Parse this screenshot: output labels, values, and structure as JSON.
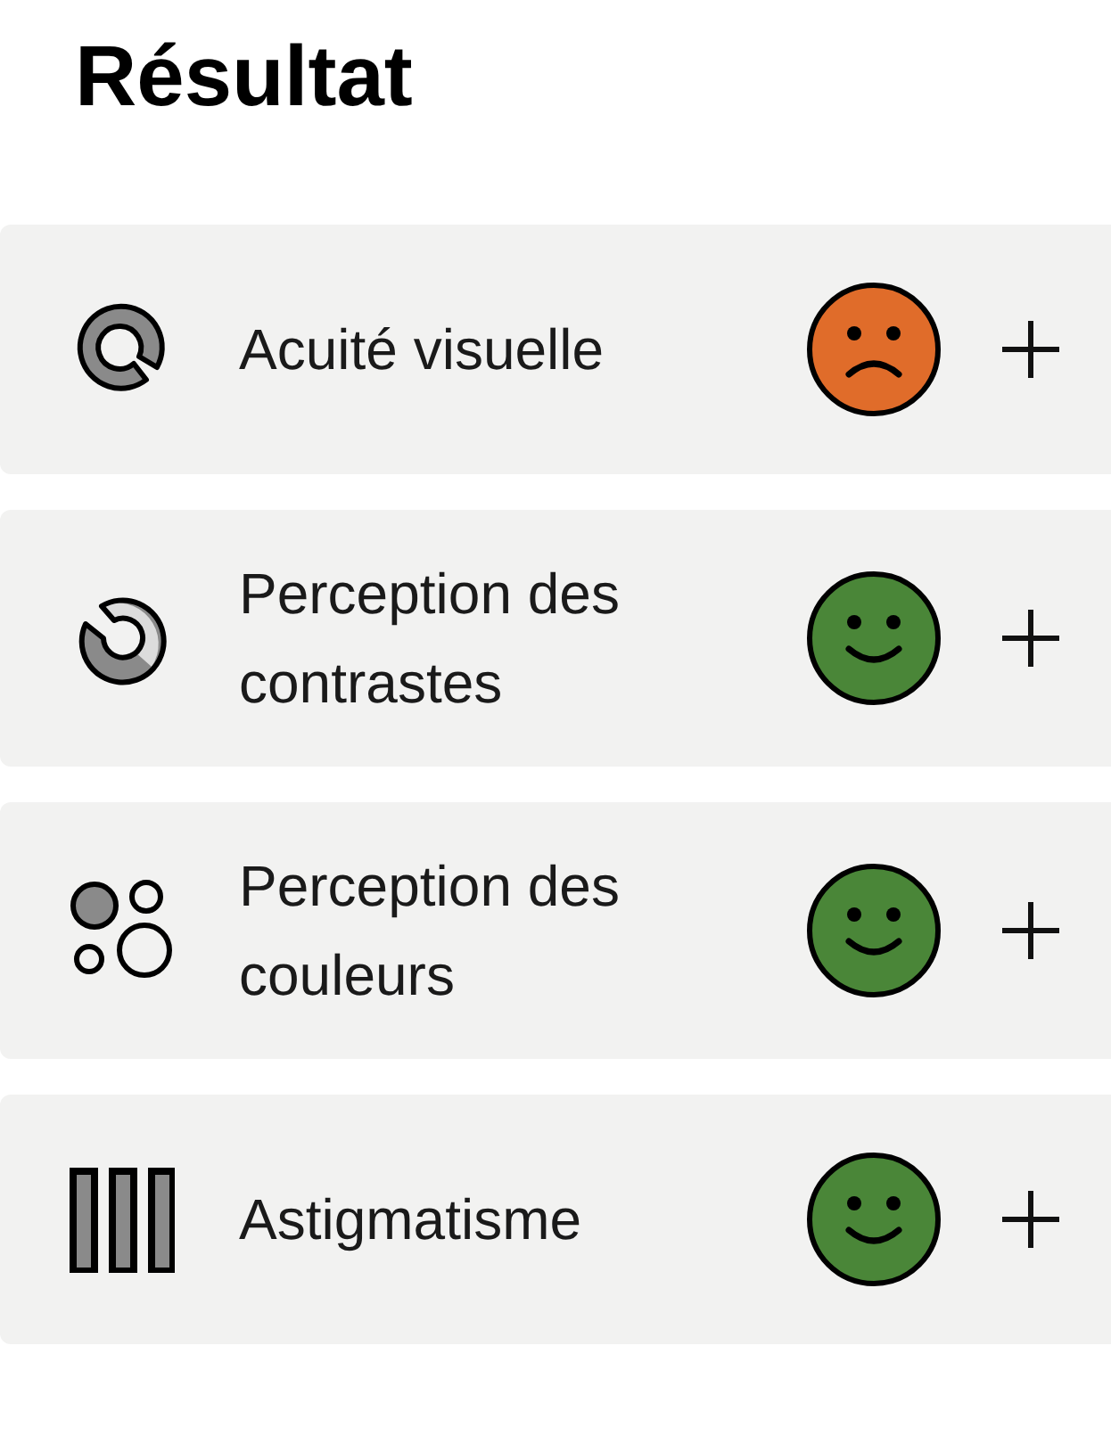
{
  "title": "Résultat",
  "tests": [
    {
      "kind": "acuity",
      "label": "Acuité visuelle",
      "passed": false
    },
    {
      "kind": "contrast",
      "label": "Perception des contrastes",
      "passed": true
    },
    {
      "kind": "color",
      "label": "Perception des couleurs",
      "passed": true
    },
    {
      "kind": "astigmatism",
      "label": "Astigmatisme",
      "passed": true
    }
  ]
}
